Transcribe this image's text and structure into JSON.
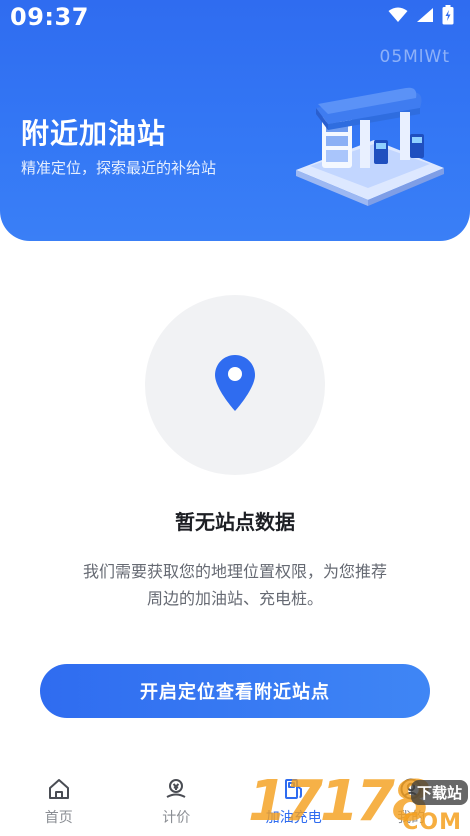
{
  "status_bar": {
    "time": "09:37"
  },
  "header": {
    "watermark": "05MlWt",
    "title": "附近加油站",
    "subtitle": "精准定位，探索最近的补给站"
  },
  "empty_state": {
    "title": "暂无站点数据",
    "description_line1": "我们需要获取您的地理位置权限，为您推荐",
    "description_line2": "周边的加油站、充电桩。"
  },
  "cta": {
    "label": "开启定位查看附近站点"
  },
  "tabs": [
    {
      "label": "首页",
      "icon": "home-icon"
    },
    {
      "label": "计价",
      "icon": "price-icon"
    },
    {
      "label": "加油充电",
      "icon": "fuel-pump-icon",
      "active": true
    },
    {
      "label": "我的",
      "icon": "user-icon"
    }
  ],
  "site_logo": {
    "digits": "17178",
    "badge": "下载站",
    "sub": "COM"
  },
  "colors": {
    "primary": "#2f6cf0",
    "header_gradient_end": "#3a7ff6",
    "empty_circle": "#f1f2f4",
    "pin": "#2f6cf0",
    "tab_inactive": "#8a8d93"
  }
}
